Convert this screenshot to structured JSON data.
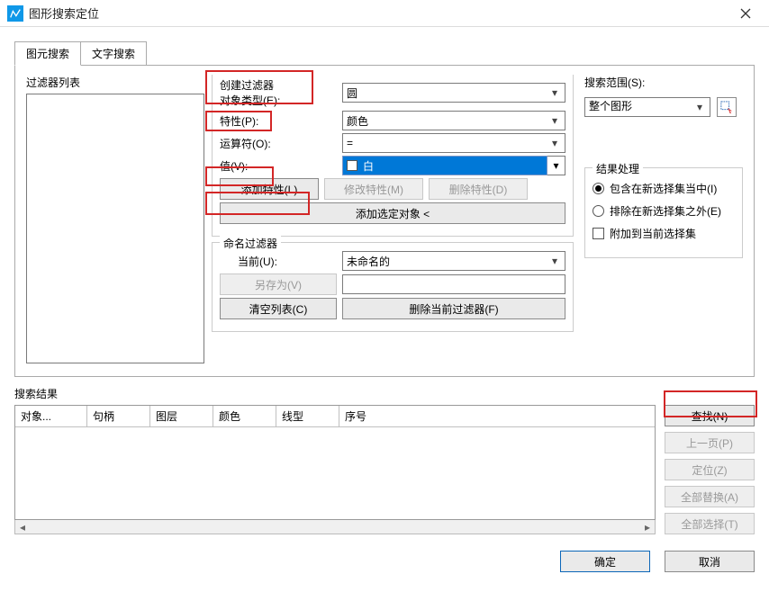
{
  "window": {
    "title": "图形搜索定位"
  },
  "tabs": {
    "t1": "图元搜索",
    "t2": "文字搜索"
  },
  "filter_list_label": "过滤器列表",
  "create": {
    "legend": "创建过滤器",
    "object_type_label": "对象类型(E):",
    "object_type_value": "圆",
    "property_label": "特性(P):",
    "property_value": "颜色",
    "operator_label": "运算符(O):",
    "operator_value": "=",
    "value_label": "值(V):",
    "value_display": "白",
    "add_prop_btn": "添加特性(L)",
    "mod_prop_btn": "修改特性(M)",
    "del_prop_btn": "删除特性(D)",
    "add_selected_btn": "添加选定对象 <"
  },
  "named": {
    "legend": "命名过滤器",
    "current_label": "当前(U):",
    "current_value": "未命名的",
    "saveas_btn": "另存为(V)",
    "name_value": "",
    "clear_btn": "清空列表(C)",
    "del_current_btn": "删除当前过滤器(F)"
  },
  "scope": {
    "label": "搜索范围(S):",
    "value": "整个图形"
  },
  "result_proc": {
    "legend": "结果处理",
    "r_include": "包含在新选择集当中(I)",
    "r_exclude": "排除在新选择集之外(E)",
    "chk_append": "附加到当前选择集"
  },
  "results": {
    "label": "搜索结果",
    "cols": {
      "c1": "对象...",
      "c2": "句柄",
      "c3": "图层",
      "c4": "颜色",
      "c5": "线型",
      "c6": "序号"
    }
  },
  "side": {
    "find": "查找(N)",
    "prev": "上一页(P)",
    "locate": "定位(Z)",
    "replace_all": "全部替换(A)",
    "select_all": "全部选择(T)"
  },
  "footer": {
    "ok": "确定",
    "cancel": "取消"
  }
}
